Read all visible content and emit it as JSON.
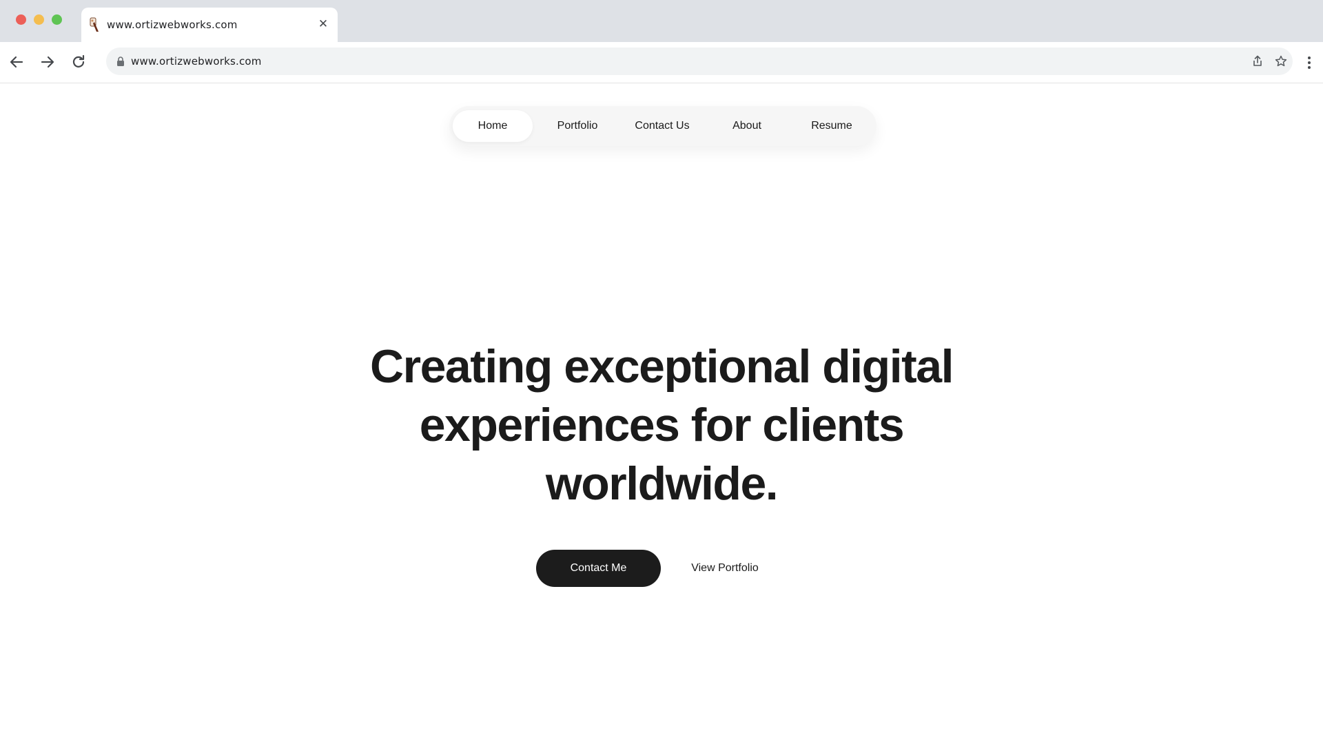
{
  "browser": {
    "tab_title": "www.ortizwebworks.com",
    "url": "www.ortizwebworks.com",
    "icons": {
      "close": "close-icon",
      "back": "back-arrow-icon",
      "forward": "forward-arrow-icon",
      "reload": "reload-icon",
      "lock": "lock-icon",
      "share": "share-icon",
      "bookmark": "star-icon",
      "menu": "more-vertical-icon"
    }
  },
  "nav": {
    "items": [
      {
        "label": "Home",
        "active": true
      },
      {
        "label": "Portfolio",
        "active": false
      },
      {
        "label": "Contact Us",
        "active": false
      },
      {
        "label": "About",
        "active": false
      },
      {
        "label": "Resume",
        "active": false
      }
    ]
  },
  "hero": {
    "lines": [
      "Creating exceptional digital",
      "experiences for clients",
      "worldwide."
    ],
    "primary_cta": "Contact Me",
    "secondary_cta": "View Portfolio"
  },
  "colors": {
    "accent": "#1c1c1c",
    "text": "#1b1b1b",
    "nav_bg": "#f6f6f6",
    "chrome_bg": "#dee1e6"
  }
}
